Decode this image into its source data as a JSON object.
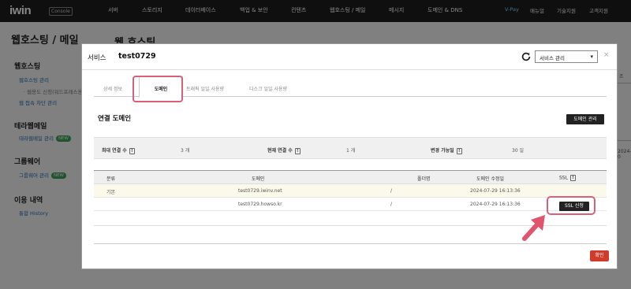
{
  "topnav": {
    "logo": "iwin",
    "logo_badge": "Console",
    "items": [
      "서버",
      "스토리지",
      "데이터베이스",
      "백업 & 보안",
      "컨텐츠",
      "웹호스팅 / 메일",
      "메시지",
      "도메인 & DNS"
    ],
    "right": [
      "V-Pay",
      "매뉴얼",
      "기술지원",
      "고객지원"
    ]
  },
  "background": {
    "page_title": "웹호스팅 / 메일",
    "page_title2": "웹 호스팅",
    "sidebar": {
      "web_hosting": "웹호스팅",
      "web_hosting_items": [
        "웹호스팅 관리",
        "· 웹용도 신청(워드프레스용)",
        "웹 접속 차단 관리"
      ],
      "terra_mail": "테라웹메일",
      "terra_mail_item": "테라웹메일 관리",
      "groupware": "그룹웨어",
      "groupware_item": "그룹웨어 관리",
      "new_badge": "NEW",
      "usage": "이용 내역",
      "usage_item": "통합 History"
    },
    "right_texts": [
      "조",
      "2024-0"
    ]
  },
  "modal": {
    "title": "서비스",
    "service_name": "test0729",
    "service_select": "서비스 관리",
    "close": "×",
    "tabs": [
      "상세 정보",
      "도메인",
      "트래픽 일일 사용량",
      "디스크 일일 사용량"
    ],
    "section_title": "연결 도메인",
    "manage_button": "도메인 관리",
    "stats": {
      "max_label": "최대 연결 수",
      "max_value": "3 개",
      "current_label": "현재 연결 수",
      "current_value": "1 개",
      "change_label": "변경 가능일",
      "change_value": "30 일"
    },
    "table": {
      "headers": [
        "분류",
        "도메인",
        "폴더명",
        "도메인 수정일",
        "SSL"
      ],
      "rows": [
        {
          "type": "기본",
          "domain": "test0729.iwinv.net",
          "folder": "/",
          "date": "2024-07-29 16:13:36",
          "ssl": ""
        },
        {
          "type": "",
          "domain": "test0729.howso.kr",
          "folder": "/",
          "date": "2024-07-29 16:13:36",
          "ssl": "SSL 신청"
        }
      ]
    },
    "ok_button": "확인"
  },
  "colors": {
    "highlight": "#d9607a",
    "ok_button": "#d23a2a",
    "nav_bg": "#1e1e1e"
  }
}
